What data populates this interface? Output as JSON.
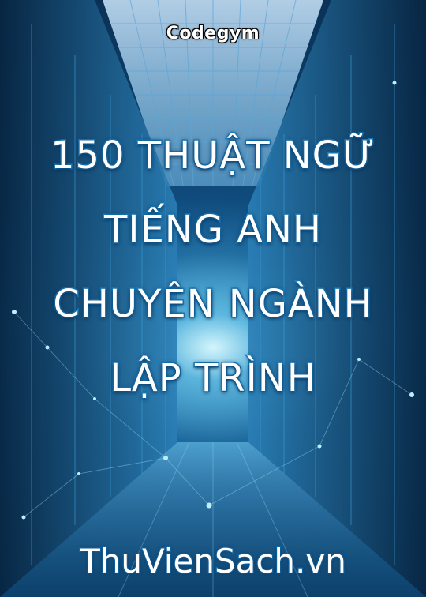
{
  "cover": {
    "brand": "Codegym",
    "title_lines": [
      "150 THUẬT NGỮ",
      "TIẾNG ANH",
      "CHUYÊN NGÀNH",
      "LẬP TRÌNH"
    ],
    "footer_brand": "ThuVienSach.vn"
  },
  "colors": {
    "background_dark": "#0b3156",
    "background_mid": "#1a6fa6",
    "title_stroke": "#1f86c4",
    "text": "#ffffff"
  }
}
